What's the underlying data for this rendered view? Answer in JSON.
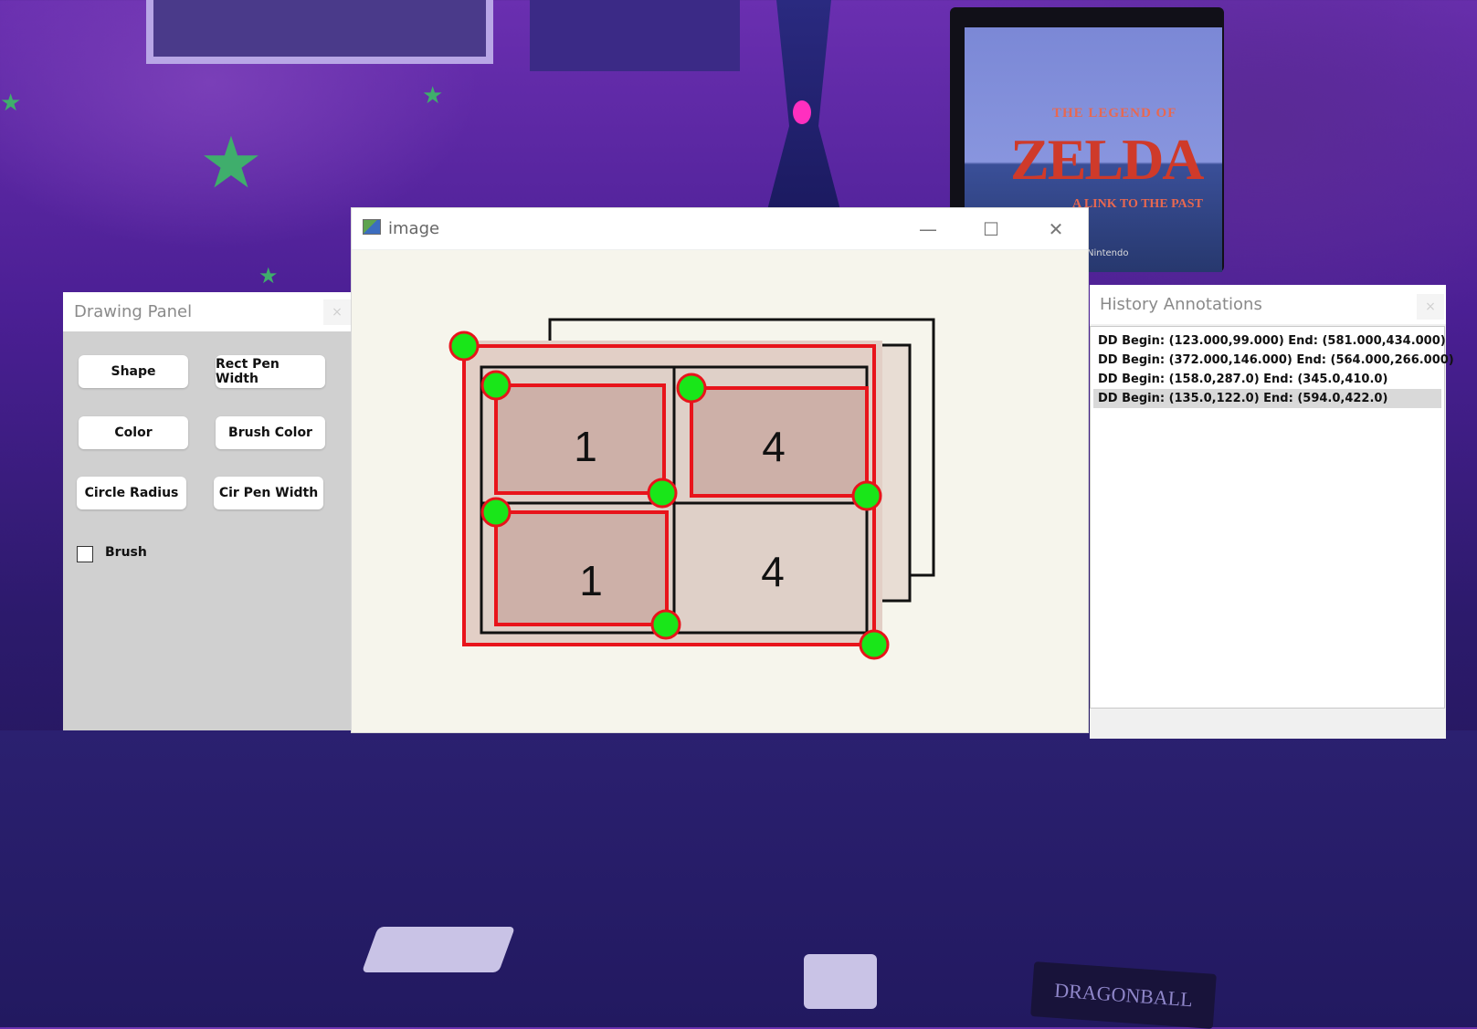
{
  "drawing_panel": {
    "title": "Drawing Panel",
    "close": "×",
    "buttons": {
      "shape": "Shape",
      "rect_pen_width": "Rect Pen Width",
      "color": "Color",
      "brush_color": "Brush Color",
      "circle_radius": "Circle Radius",
      "cir_pen_width": "Cir Pen Width"
    },
    "brush_label": "Brush",
    "brush_checked": false
  },
  "image_window": {
    "title": "image",
    "minimize": "—",
    "maximize": "☐",
    "close": "✕",
    "cell_labels": [
      "1",
      "4",
      "1",
      "4"
    ]
  },
  "history_panel": {
    "title": "History Annotations",
    "close": "×",
    "items": [
      "DD  Begin: (123.000,99.000)  End: (581.000,434.000)",
      "DD  Begin: (372.000,146.000)  End: (564.000,266.000)",
      "DD  Begin: (158.0,287.0)  End: (345.0,410.0)",
      "DD  Begin: (135.0,122.0)  End: (594.0,422.0)"
    ],
    "selected_index": 3
  },
  "wallpaper": {
    "tv_text_top": "THE LEGEND OF",
    "tv_text_big": "ZELDA",
    "tv_text_sub": "A LINK TO THE PAST",
    "tv_brand": "Nintendo",
    "box_label": "DRAGONBALL"
  },
  "colors": {
    "annotation_stroke": "#e8141b",
    "handle_fill": "#19e619",
    "selection_fill": "#cfb4a8",
    "canvas_bg": "#f6f5ec"
  }
}
